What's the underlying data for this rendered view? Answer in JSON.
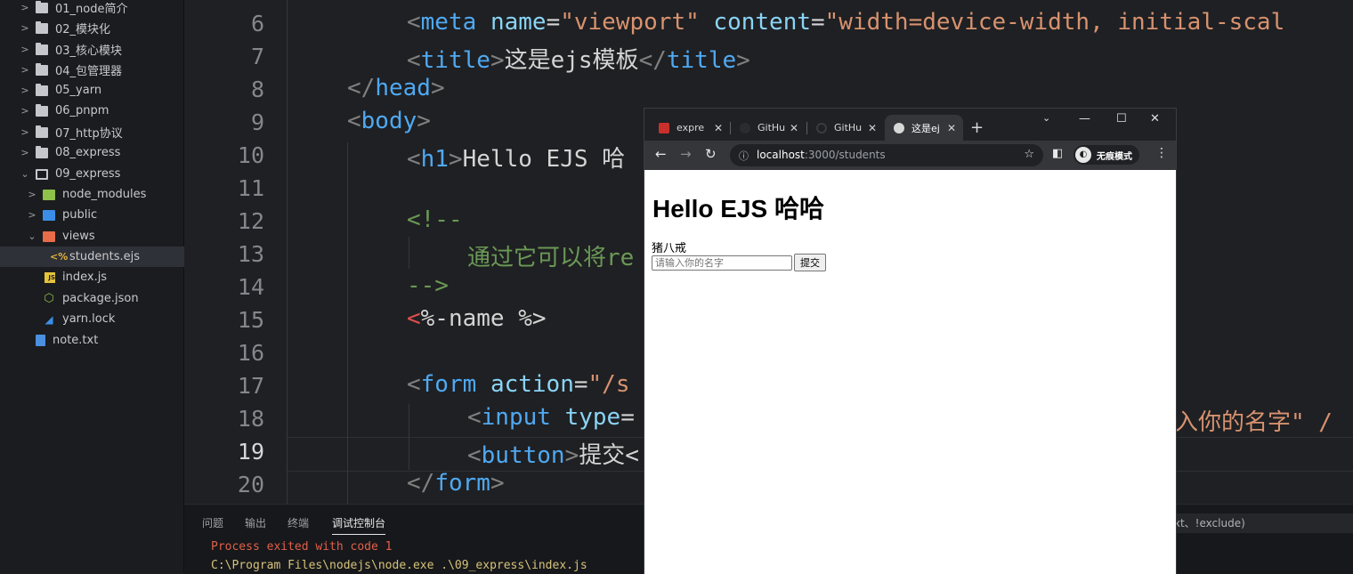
{
  "sidebar": {
    "items": [
      {
        "label": "01_node简介"
      },
      {
        "label": "02_模块化"
      },
      {
        "label": "03_核心模块"
      },
      {
        "label": "04_包管理器"
      },
      {
        "label": "05_yarn"
      },
      {
        "label": "06_pnpm"
      },
      {
        "label": "07_http协议"
      },
      {
        "label": "08_express"
      },
      {
        "label": "09_express"
      },
      {
        "label": "node_modules"
      },
      {
        "label": "public"
      },
      {
        "label": "views"
      },
      {
        "label": "students.ejs"
      },
      {
        "label": "index.js"
      },
      {
        "label": "package.json"
      },
      {
        "label": "yarn.lock"
      },
      {
        "label": "note.txt"
      }
    ]
  },
  "editor": {
    "line_numbers": [
      "6",
      "7",
      "8",
      "9",
      "10",
      "11",
      "12",
      "13",
      "14",
      "15",
      "16",
      "17",
      "18",
      "19",
      "20"
    ],
    "active_line": "19",
    "code": {
      "l6": [
        "<",
        "meta",
        " ",
        "name",
        "=",
        "\"viewport\"",
        " ",
        "content",
        "=",
        "\"width=device-width, initial-scal"
      ],
      "l7": [
        "<",
        "title",
        ">",
        "这是ejs模板",
        "</",
        "title",
        ">"
      ],
      "l8": [
        "</",
        "head",
        ">"
      ],
      "l9": [
        "<",
        "body",
        ">"
      ],
      "l10": [
        "<",
        "h1",
        ">",
        "Hello EJS 哈"
      ],
      "l12": "<!--",
      "l13": "通过它可以将re",
      "l14": "-->",
      "l15": [
        "<",
        "%-name %>"
      ],
      "l17": [
        "<",
        "form",
        " ",
        "action",
        "=",
        "\"/s"
      ],
      "l18a": [
        "<",
        "input",
        " ",
        "type",
        "="
      ],
      "l18b": "入你的名字\" /",
      "l19": [
        "<",
        "button",
        ">",
        "提交<"
      ],
      "l20": [
        "</",
        "form",
        ">"
      ]
    }
  },
  "panel": {
    "tabs": [
      "问题",
      "输出",
      "终端",
      "调试控制台"
    ],
    "terminal_lines": [
      "Process exited with code 1",
      "C:\\Program Files\\nodejs\\node.exe .\\09_express\\index.js"
    ],
    "filter_text": "text、!exclude)"
  },
  "browser": {
    "tabs": [
      {
        "title": "expre"
      },
      {
        "title": "GitHu"
      },
      {
        "title": "GitHu"
      },
      {
        "title": "这是ej"
      }
    ],
    "new_tab": "+",
    "url_host": "localhost",
    "url_rest": ":3000/students",
    "profile_label": "无痕模式",
    "page": {
      "heading": "Hello EJS 哈哈",
      "name": "猪八戒",
      "input_placeholder": "请输入你的名字",
      "submit_label": "提交"
    }
  },
  "colors": {
    "tag": "#808080",
    "tag_name": "#4fa9f2",
    "attr": "#8ad4f5",
    "string": "#d7926f",
    "comment": "#6a9955",
    "error_text": "#e0604a",
    "path_text": "#d6c27a"
  }
}
